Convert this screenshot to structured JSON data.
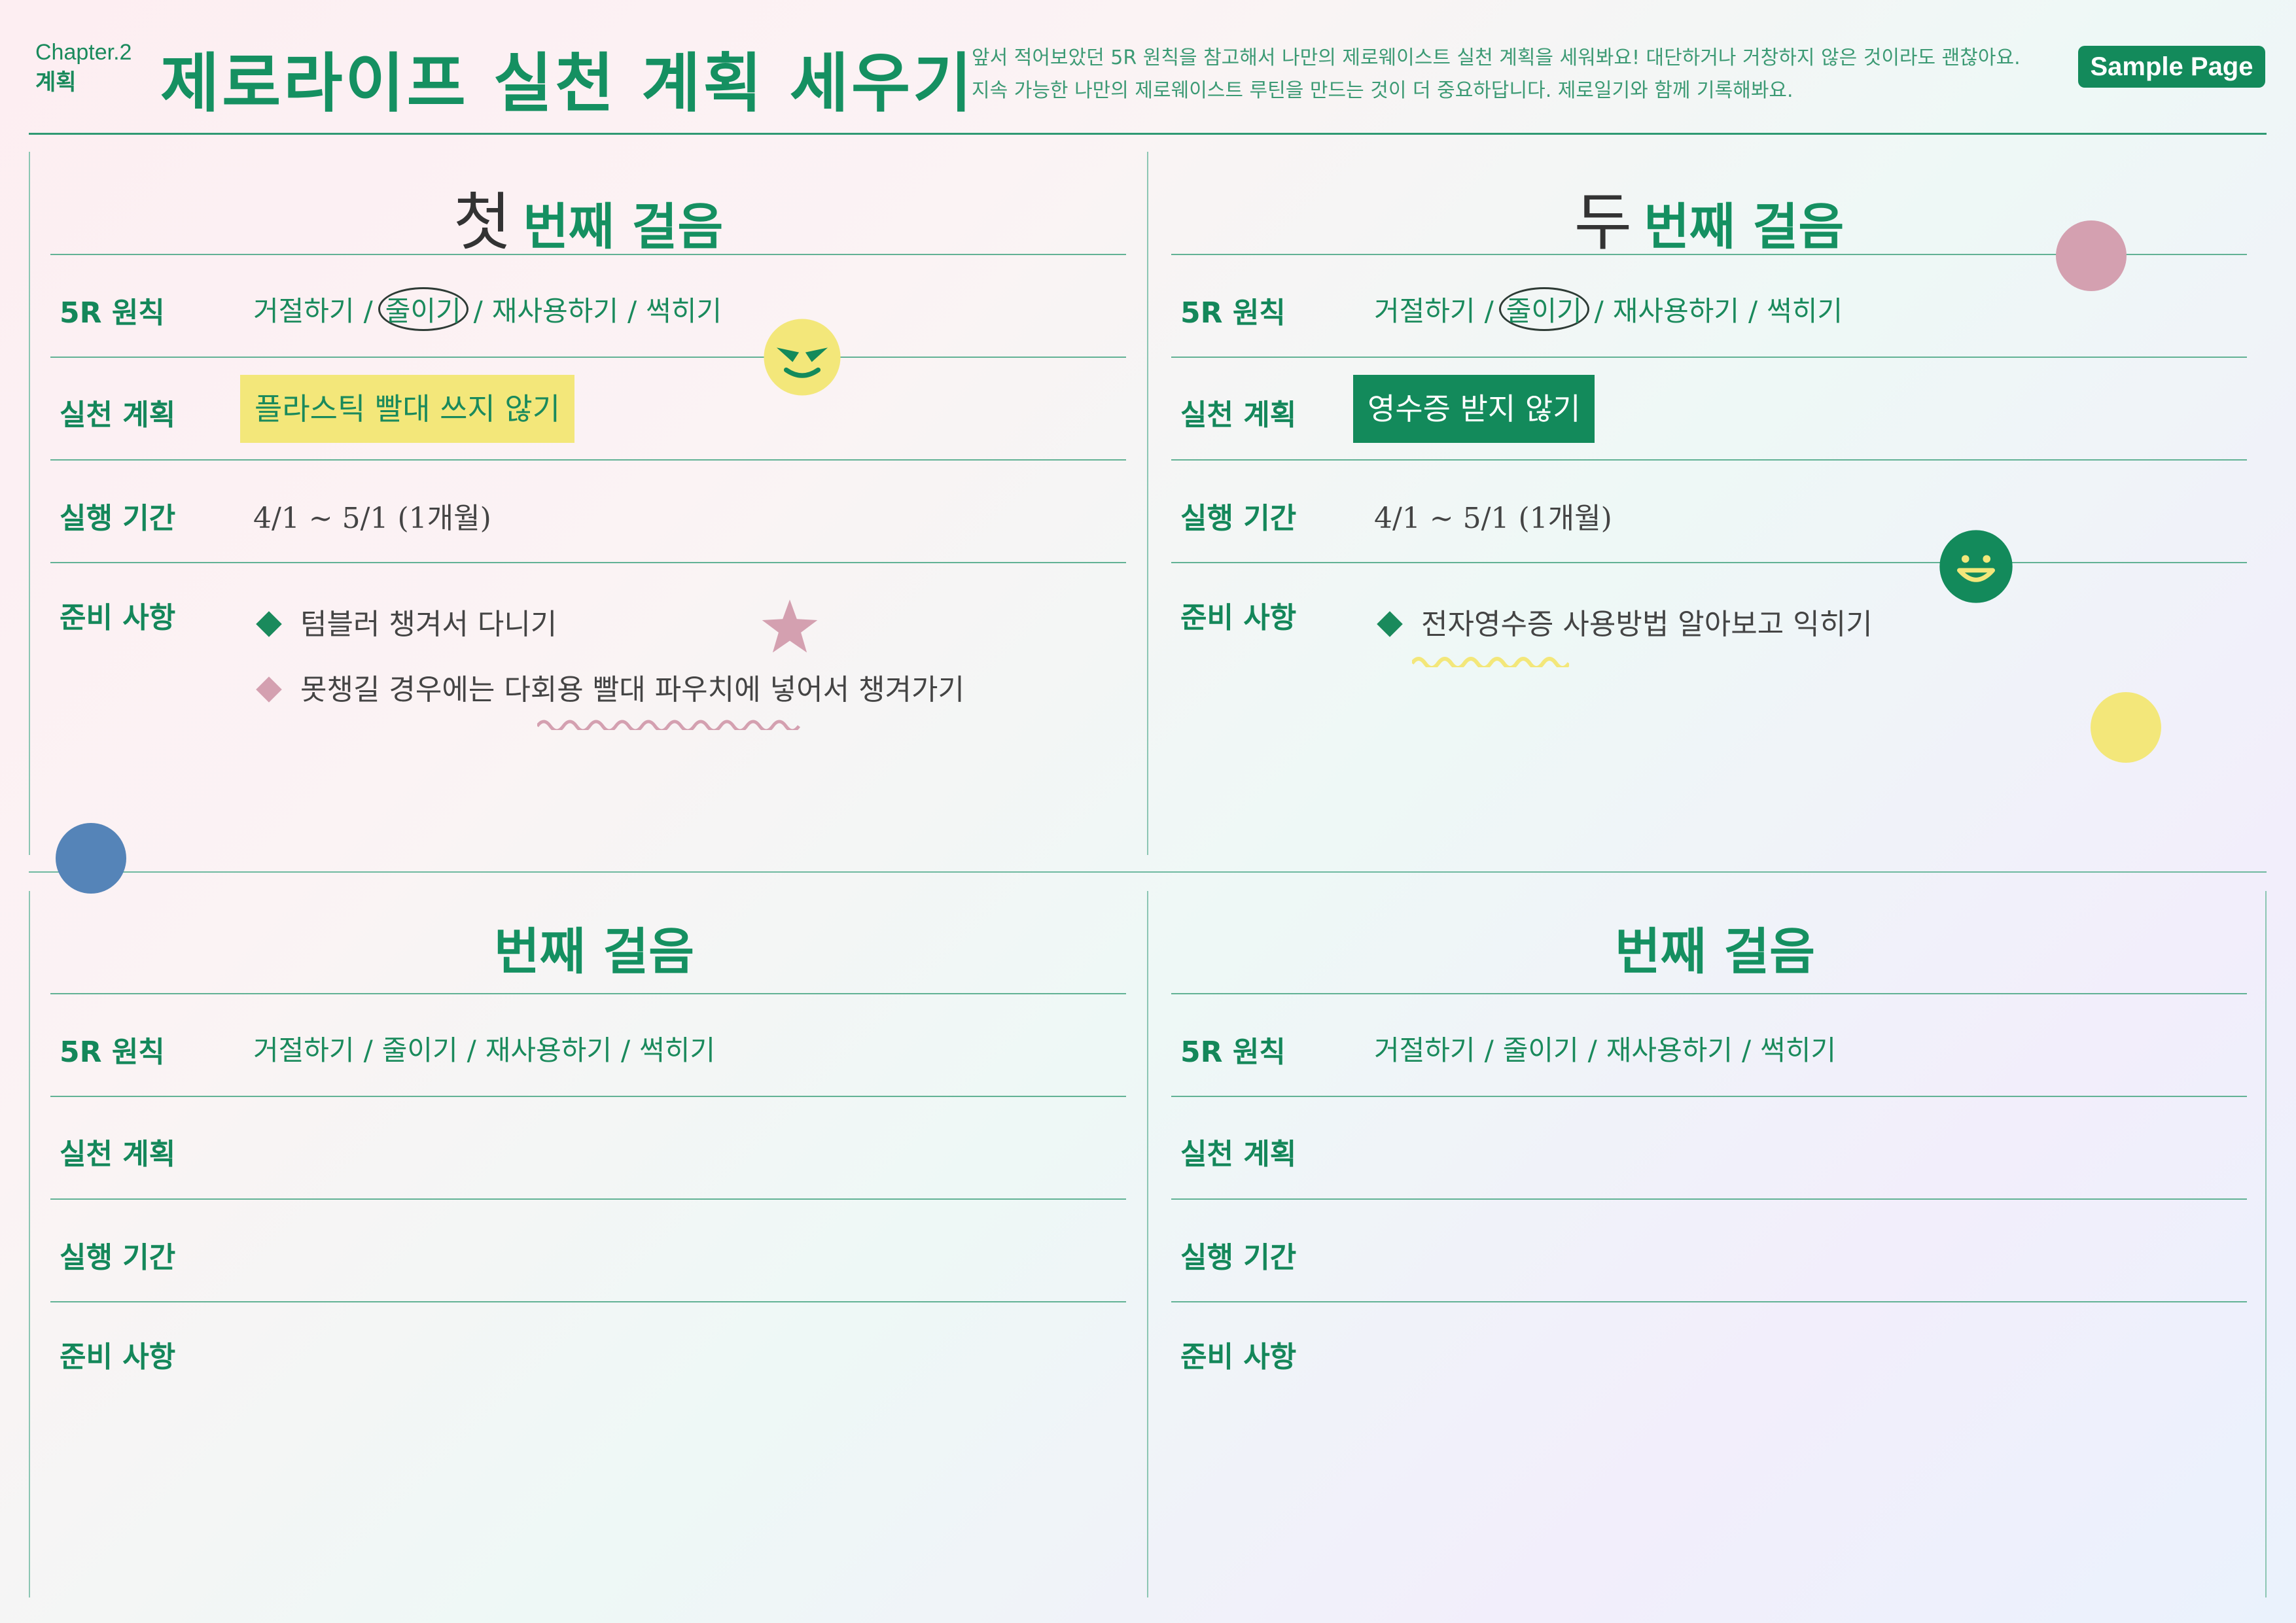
{
  "header": {
    "chapter": "Chapter.2",
    "chapter_sub": "계획",
    "title": "제로라이프 실천 계획 세우기",
    "desc_line1": "앞서 적어보았던 5R 원칙을 참고해서 나만의 제로웨이스트 실천 계획을 세워봐요! 대단하거나 거창하지 않은 것이라도 괜찮아요.",
    "desc_line2": "지속 가능한 나만의 제로웨이스트 루틴을 만드는 것이 더 중요하답니다. 제로일기와 함께 기록해봐요.",
    "badge": "Sample Page"
  },
  "labels": {
    "r5": "5R 원칙",
    "plan": "실천 계획",
    "period": "실행 기간",
    "prep": "준비 사항"
  },
  "r5_options": [
    "거절하기",
    "줄이기",
    "재사용하기",
    "썩히기"
  ],
  "r5_sep": "/",
  "step_suffix": "번째 걸음",
  "panels": [
    {
      "number": "첫",
      "selected": "줄이기",
      "plan": "플라스틱 빨대 쓰지 않기",
      "period": "4/1 ~ 5/1 (1개월)",
      "prep": [
        "텀블러 챙겨서 다니기",
        "못챙길 경우에는 다회용 빨대 파우치에 넣어서 챙겨가기"
      ]
    },
    {
      "number": "두",
      "selected": "줄이기",
      "plan": "영수증 받지 않기",
      "period": "4/1 ~ 5/1 (1개월)",
      "prep": [
        "전자영수증 사용방법 알아보고 익히기"
      ]
    },
    {
      "number": "",
      "selected": "",
      "plan": "",
      "period": "",
      "prep": []
    },
    {
      "number": "",
      "selected": "",
      "plan": "",
      "period": "",
      "prep": []
    }
  ],
  "colors": {
    "brand_green": "#159061",
    "yellow_highlight": "#f3e77a",
    "green_highlight": "#138a5b",
    "pink": "#d4a0b0",
    "blue": "#5584b8",
    "yellow": "#f3e77a"
  }
}
